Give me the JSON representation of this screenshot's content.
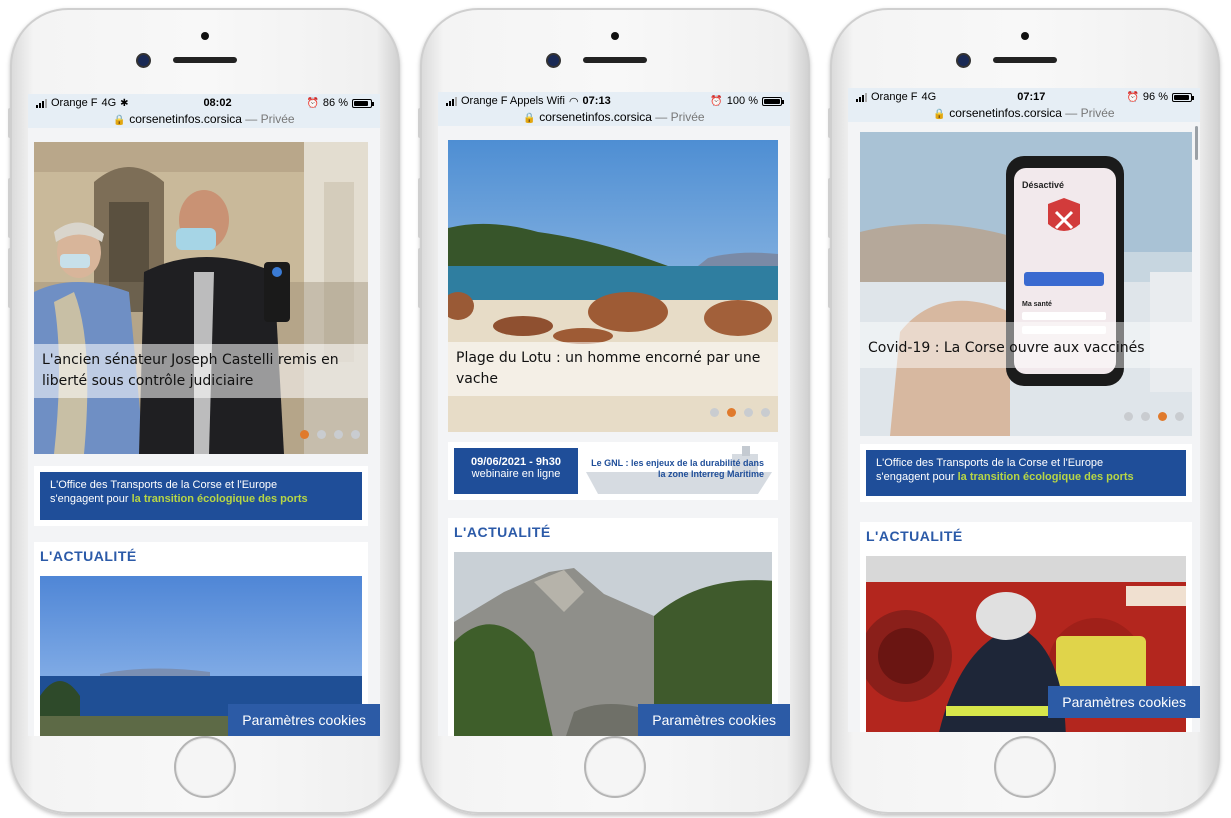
{
  "phones": [
    {
      "status": {
        "carrier": "Orange F",
        "network": "4G",
        "time": "08:02",
        "battery": "86 %"
      },
      "url": {
        "domain": "corsenetinfos.corsica",
        "suffix": "— Privée"
      },
      "slide": {
        "caption": "L'ancien sénateur Joseph Castelli remis en liberté sous contrôle judiciaire",
        "active_dot": 0
      },
      "banner": {
        "line1": "L'Office des Transports de la Corse et l'Europe",
        "line2_prefix": "s'engagent pour ",
        "highlight": "la transition écologique des ports"
      },
      "section_title": "L'ACTUALITÉ",
      "cookie_button": "Paramètres cookies"
    },
    {
      "status": {
        "carrier": "Orange F Appels Wifi",
        "network": "",
        "time": "07:13",
        "battery": "100 %"
      },
      "url": {
        "domain": "corsenetinfos.corsica",
        "suffix": "— Privée"
      },
      "slide": {
        "caption": "Plage du Lotu : un homme encorné par une vache",
        "active_dot": 1
      },
      "webinar": {
        "date": "09/06/2021 - 9h30",
        "subtitle": "webinaire en ligne",
        "title": "Le GNL : les enjeux de la durabilité dans la zone Interreg Maritime"
      },
      "section_title": "L'ACTUALITÉ",
      "cookie_button": "Paramètres cookies"
    },
    {
      "status": {
        "carrier": "Orange F",
        "network": "4G",
        "time": "07:17",
        "battery": "96 %"
      },
      "url": {
        "domain": "corsenetinfos.corsica",
        "suffix": "— Privée"
      },
      "slide": {
        "caption": "Covid-19 : La Corse ouvre aux vaccinés",
        "active_dot": 2,
        "phone_screen_title": "Désactivé",
        "phone_screen_section": "Ma santé"
      },
      "banner": {
        "line1": "L'Office des Transports de la Corse et l'Europe",
        "line2_prefix": "s'engagent pour ",
        "highlight": "la transition écologique des ports"
      },
      "section_title": "L'ACTUALITÉ",
      "cookie_button": "Paramètres cookies"
    }
  ]
}
